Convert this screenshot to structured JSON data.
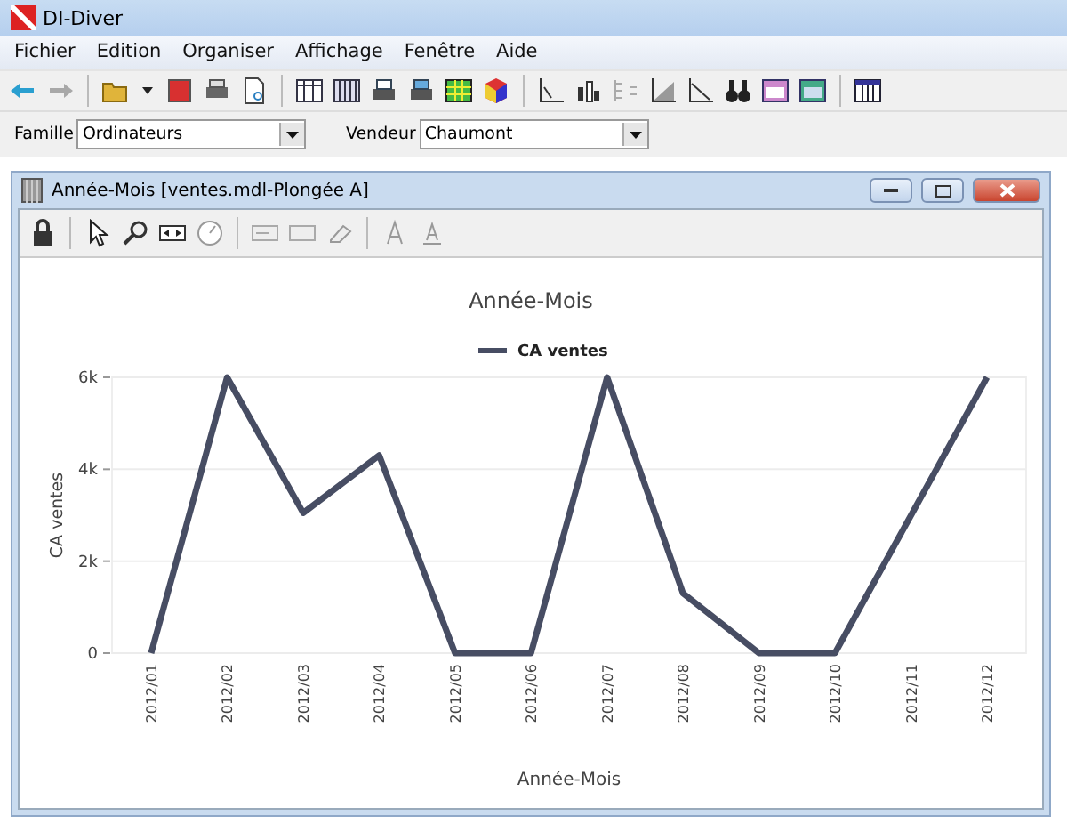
{
  "app": {
    "title": "DI-Diver"
  },
  "menu": [
    "Fichier",
    "Edition",
    "Organiser",
    "Affichage",
    "Fenêtre",
    "Aide"
  ],
  "filters": [
    {
      "label": "Famille",
      "value": "Ordinateurs"
    },
    {
      "label": "Vendeur",
      "value": "Chaumont"
    }
  ],
  "document": {
    "title": "Année-Mois [ventes.mdl-Plongée A]",
    "chart_data": {
      "type": "line",
      "title": "Année-Mois",
      "xlabel": "Année-Mois",
      "ylabel": "CA ventes",
      "categories": [
        "2012/01",
        "2012/02",
        "2012/03",
        "2012/04",
        "2012/05",
        "2012/06",
        "2012/07",
        "2012/08",
        "2012/09",
        "2012/10",
        "2012/11",
        "2012/12"
      ],
      "series": [
        {
          "name": "CA ventes",
          "color": "#474d63",
          "values": [
            0,
            6000,
            3050,
            4300,
            0,
            0,
            6000,
            1300,
            0,
            0,
            3000,
            6000
          ]
        }
      ],
      "ylim": [
        0,
        6000
      ],
      "yticks": [
        {
          "value": 0,
          "label": "0"
        },
        {
          "value": 2000,
          "label": "2k"
        },
        {
          "value": 4000,
          "label": "4k"
        },
        {
          "value": 6000,
          "label": "6k"
        }
      ]
    }
  }
}
